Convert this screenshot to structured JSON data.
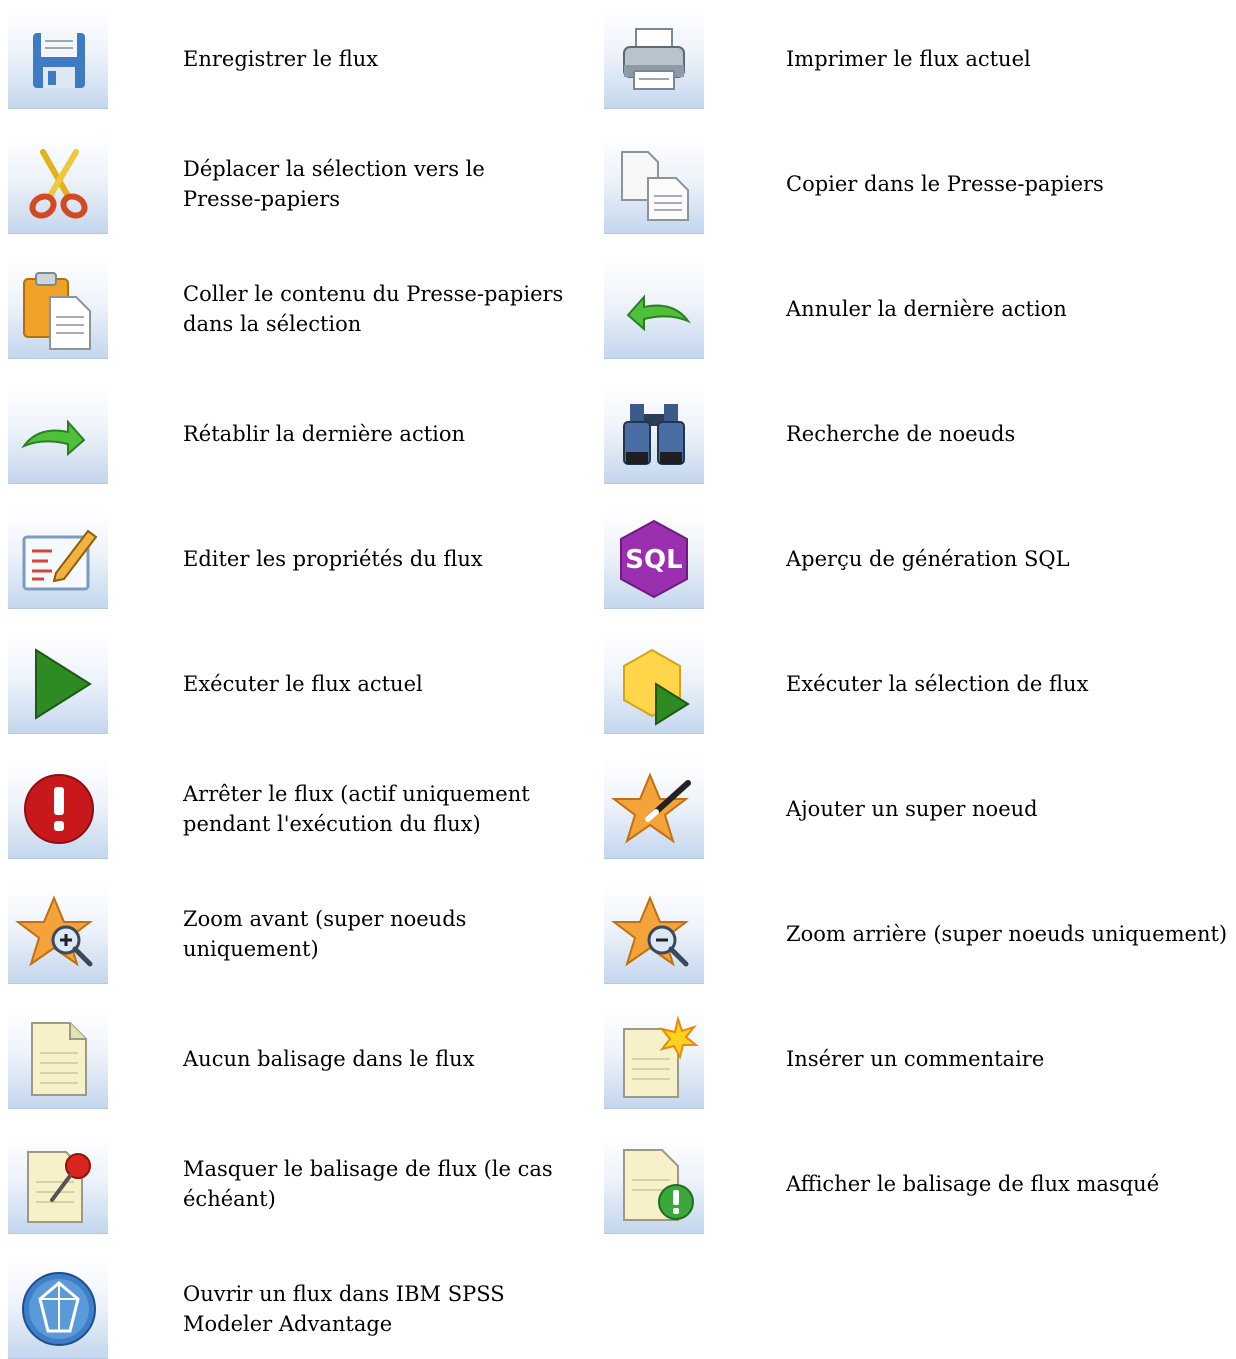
{
  "rows": [
    {
      "left": {
        "icon": "save-icon",
        "label": "Enregistrer le flux"
      },
      "right": {
        "icon": "print-icon",
        "label": "Imprimer le flux actuel"
      }
    },
    {
      "left": {
        "icon": "cut-icon",
        "label": "Déplacer la sélection vers le\nPresse-papiers"
      },
      "right": {
        "icon": "copy-icon",
        "label": "Copier dans le Presse-papiers"
      }
    },
    {
      "left": {
        "icon": "paste-icon",
        "label": "Coller le contenu du Presse-papiers\ndans la sélection"
      },
      "right": {
        "icon": "undo-icon",
        "label": "Annuler la dernière action"
      }
    },
    {
      "left": {
        "icon": "redo-icon",
        "label": "Rétablir la dernière action"
      },
      "right": {
        "icon": "binoculars-icon",
        "label": "Recherche de noeuds"
      }
    },
    {
      "left": {
        "icon": "edit-properties-icon",
        "label": "Editer les propriétés du flux"
      },
      "right": {
        "icon": "sql-icon",
        "sql_text": "SQL",
        "label": "Aperçu de génération SQL"
      }
    },
    {
      "left": {
        "icon": "run-icon",
        "label": "Exécuter le flux actuel"
      },
      "right": {
        "icon": "run-selection-icon",
        "label": "Exécuter la sélection de flux"
      }
    },
    {
      "left": {
        "icon": "stop-icon",
        "label": "Arrêter le flux (actif uniquement\npendant l'exécution du flux)"
      },
      "right": {
        "icon": "add-supernode-icon",
        "label": "Ajouter un super noeud"
      }
    },
    {
      "left": {
        "icon": "zoom-in-icon",
        "label": "Zoom avant (super noeuds\nuniquement)"
      },
      "right": {
        "icon": "zoom-out-icon",
        "label": "Zoom arrière (super noeuds uniquement)"
      }
    },
    {
      "left": {
        "icon": "no-markup-icon",
        "label": "Aucun balisage dans le flux"
      },
      "right": {
        "icon": "insert-comment-icon",
        "label": "Insérer un commentaire"
      }
    },
    {
      "left": {
        "icon": "hide-markup-icon",
        "label": "Masquer le balisage de flux (le cas\néchéant)"
      },
      "right": {
        "icon": "show-markup-icon",
        "label": "Afficher le balisage de flux masqué"
      }
    },
    {
      "left": {
        "icon": "modeler-advantage-icon",
        "label": "Ouvrir un flux dans IBM SPSS\nModeler Advantage"
      },
      "right": null
    }
  ],
  "colors": {
    "tile_top": "#ffffff",
    "tile_bottom": "#c3d6ed",
    "run_green": "#2e8a22",
    "stop_red": "#c8181c",
    "sql_purple": "#9a2fb0",
    "star_orange": "#f4a23a"
  }
}
